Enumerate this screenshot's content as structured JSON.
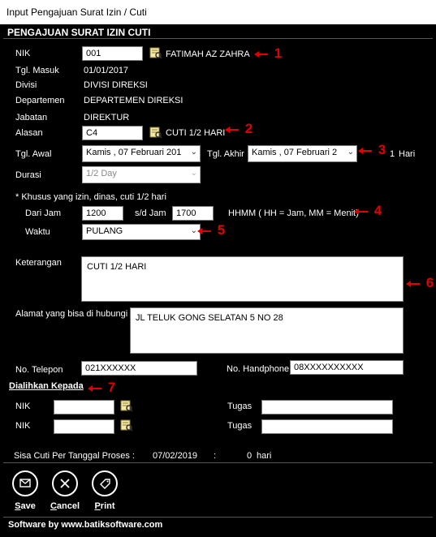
{
  "window": {
    "title": "Input Pengajuan Surat Izin / Cuti"
  },
  "header": "PENGAJUAN SURAT IZIN CUTI",
  "form": {
    "nik_label": "NIK",
    "nik_value": "001",
    "employee_name": "FATIMAH AZ ZAHRA",
    "tgl_masuk_label": "Tgl. Masuk",
    "tgl_masuk_value": "01/01/2017",
    "divisi_label": "Divisi",
    "divisi_value": "DIVISI DIREKSI",
    "departemen_label": "Departemen",
    "departemen_value": "DEPARTEMEN DIREKSI",
    "jabatan_label": "Jabatan",
    "jabatan_value": "DIREKTUR",
    "alasan_label": "Alasan",
    "alasan_code": "C4",
    "alasan_desc": "CUTI 1/2 HARI",
    "tgl_awal_label": "Tgl. Awal",
    "tgl_awal_value": "Kamis , 07   Februari  201",
    "tgl_akhir_label": "Tgl. Akhir",
    "tgl_akhir_value": "Kamis , 07   Februari  2",
    "jumlah_hari": "1",
    "hari_label": "Hari",
    "durasi_label": "Durasi",
    "durasi_value": "1/2 Day",
    "khusus_note": "* Khusus yang izin, dinas, cuti 1/2 hari",
    "dari_jam_label": "Dari Jam",
    "dari_jam_value": "1200",
    "sd_jam_label": "s/d Jam",
    "sd_jam_value": "1700",
    "hhmm_note": "HHMM ( HH = Jam, MM = Menit)",
    "waktu_label": "Waktu",
    "waktu_value": "PULANG",
    "keterangan_label": "Keterangan",
    "keterangan_value": "CUTI 1/2 HARI",
    "alamat_label": "Alamat yang bisa di hubungi",
    "alamat_value": "JL TELUK GONG SELATAN 5 NO 28",
    "telepon_label": "No. Telepon",
    "telepon_value": "021XXXXXX",
    "handphone_label": "No. Handphone",
    "handphone_value": "08XXXXXXXXXX"
  },
  "dialihkan": {
    "title": "Dialihkan Kepada",
    "nik_label": "NIK",
    "tugas_label": "Tugas",
    "rows": [
      {
        "nik": "",
        "tugas": ""
      },
      {
        "nik": "",
        "tugas": ""
      }
    ]
  },
  "sisa": {
    "label": "Sisa Cuti Per Tanggal Proses :",
    "date": "07/02/2019",
    "sep": ":",
    "count": "0",
    "unit": "hari"
  },
  "annotations": [
    "1",
    "2",
    "3",
    "4",
    "5",
    "6",
    "7"
  ],
  "buttons": {
    "save_prefix": "S",
    "save_rest": "ave",
    "cancel_prefix": "C",
    "cancel_rest": "ancel",
    "print_prefix": "P",
    "print_rest": "rint"
  },
  "footer": "Software by www.batiksoftware.com",
  "colors": {
    "background": "#000000",
    "text": "#ffffff",
    "annotation": "#e00000"
  }
}
